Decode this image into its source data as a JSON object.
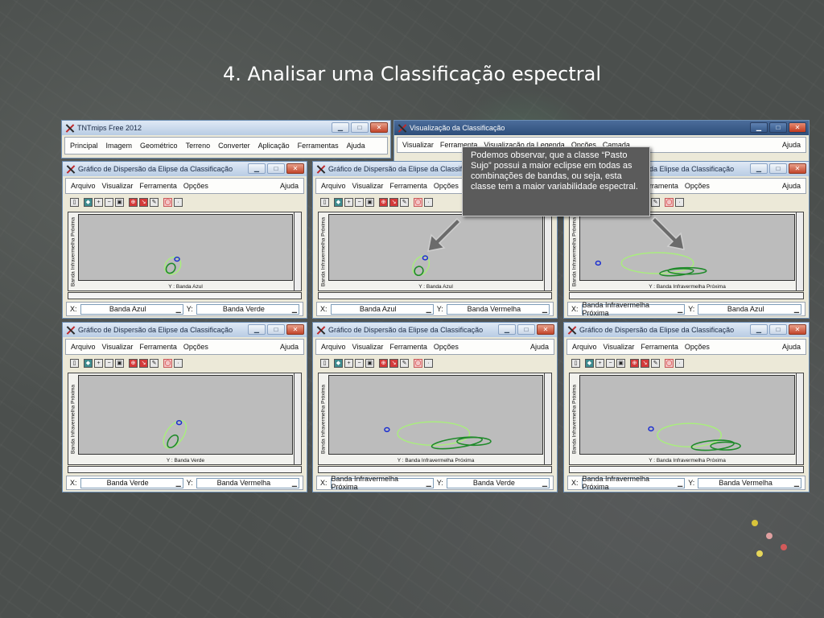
{
  "slide": {
    "title": "4. Analisar uma Classificação espectral"
  },
  "main_window": {
    "title": "TNTmips Free 2012",
    "menu": [
      "Principal",
      "Imagem",
      "Geométrico",
      "Terreno",
      "Converter",
      "Aplicação",
      "Ferramentas",
      "Ajuda"
    ]
  },
  "class_window": {
    "title": "Visualização da Classificação",
    "menu": [
      "Visualizar",
      "Ferramenta",
      "Visualização da Legenda",
      "Opções",
      "Camada"
    ],
    "help": "Ajuda"
  },
  "plot_window": {
    "title": "Gráfico de Dispersão da Elipse da Classificação",
    "menu": [
      "Arquivo",
      "Visualizar",
      "Ferramenta",
      "Opções"
    ],
    "help": "Ajuda",
    "x_prefix": "X:",
    "y_prefix": "Y:"
  },
  "plots": [
    {
      "ylabel": "Banda Infravermelha Próxima",
      "xlabel": "Y : Banda Azul",
      "x": "Banda Azul",
      "y": "Banda Verde"
    },
    {
      "ylabel": "Banda Infravermelha Próxima",
      "xlabel": "Y : Banda Azul",
      "x": "Banda Azul",
      "y": "Banda Vermelha"
    },
    {
      "ylabel": "Banda Infravermelha Próxima",
      "xlabel": "Y : Banda Infravermelha Próxima",
      "x": "Banda Infravermelha Próxima",
      "y": "Banda Azul"
    },
    {
      "ylabel": "Banda Infravermelha Próxima",
      "xlabel": "Y : Banda Verde",
      "x": "Banda Verde",
      "y": "Banda Vermelha"
    },
    {
      "ylabel": "Banda Infravermelha Próxima",
      "xlabel": "Y : Banda Infravermelha Próxima",
      "x": "Banda Infravermelha Próxima",
      "y": "Banda Verde"
    },
    {
      "ylabel": "Banda Infravermelha Próxima",
      "xlabel": "Y : Banda Infravermelha Próxima",
      "x": "Banda Infravermelha Próxima",
      "y": "Banda Vermelha"
    }
  ],
  "callout": {
    "text": "Podemos observar, que a classe “Pasto Sujo” possui a maior eclipse em todas as combinações de bandas, ou seja, esta classe tem a maior variabilidade espectral."
  },
  "colors": {
    "ellipse_light": "#a8f07a",
    "ellipse_dark": "#1f8a2a",
    "ellipse_blue": "#1c2fd0",
    "plot_bg": "#bcbcbc"
  },
  "icons": [
    "new-icon",
    "pan-icon",
    "zoom-in-icon",
    "zoom-out-icon",
    "zoom-box-icon",
    "select-icon",
    "arrow-tool-icon",
    "eraser-icon",
    "ellipse-icon",
    "dot-icon"
  ]
}
